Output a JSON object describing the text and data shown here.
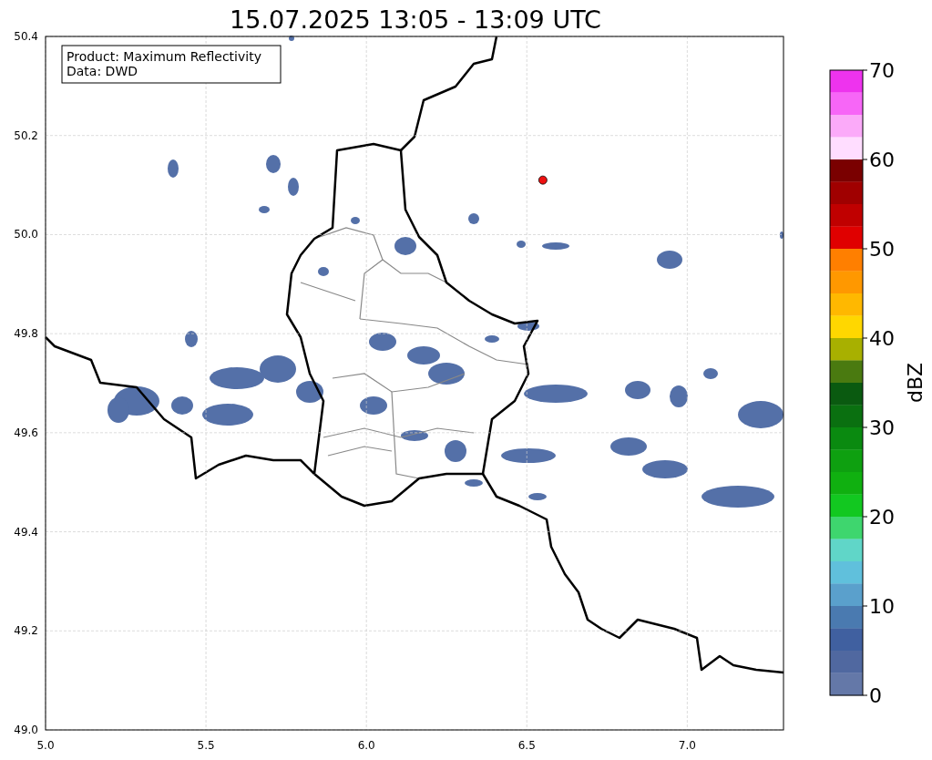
{
  "map": {
    "chart_data": {
      "type": "scatter",
      "title": "15.07.2025 13:05 - 13:09 UTC",
      "xlim": [
        5.0,
        7.3
      ],
      "ylim": [
        49.0,
        50.4
      ],
      "grid": true,
      "xticks": [
        {
          "value": 5.0,
          "label": "5.0"
        },
        {
          "value": 5.5,
          "label": "5.5"
        },
        {
          "value": 6.0,
          "label": "6.0"
        },
        {
          "value": 6.5,
          "label": "6.5"
        },
        {
          "value": 7.0,
          "label": "7.0"
        }
      ],
      "yticks": [
        {
          "value": 50.4,
          "label": "50.4"
        },
        {
          "value": 50.2,
          "label": "50.2"
        },
        {
          "value": 50.0,
          "label": "50.0"
        },
        {
          "value": 49.8,
          "label": "49.8"
        },
        {
          "value": 49.6,
          "label": "49.6"
        },
        {
          "value": 49.4,
          "label": "49.4"
        },
        {
          "value": 49.2,
          "label": "49.2"
        },
        {
          "value": 49.0,
          "label": "49.0"
        }
      ],
      "x": [
        6.55
      ],
      "series": [
        {
          "color": "#ee1111",
          "values": [
            50.11
          ]
        }
      ]
    },
    "info_box": {
      "lines": [
        "Product: Maximum Reflectivity",
        "Data: DWD"
      ]
    }
  },
  "colorbar": {
    "label": "dBZ",
    "ticks": [
      "70",
      "60",
      "50",
      "40",
      "30",
      "20",
      "10",
      "0"
    ],
    "bins": [
      {
        "color": "#ee33ee"
      },
      {
        "color": "#f766f7"
      },
      {
        "color": "#fbaaf9"
      },
      {
        "color": "#ffddff"
      },
      {
        "color": "#7a0000"
      },
      {
        "color": "#a00000"
      },
      {
        "color": "#c00000"
      },
      {
        "color": "#e00000"
      },
      {
        "color": "#ff7f00"
      },
      {
        "color": "#ff9800"
      },
      {
        "color": "#ffb800"
      },
      {
        "color": "#ffd700"
      },
      {
        "color": "#a8b000"
      },
      {
        "color": "#4a7a10"
      },
      {
        "color": "#0a5a10"
      },
      {
        "color": "#0a7010"
      },
      {
        "color": "#0a8a10"
      },
      {
        "color": "#0ea010"
      },
      {
        "color": "#10b010"
      },
      {
        "color": "#12c820"
      },
      {
        "color": "#3ed66e"
      },
      {
        "color": "#60d6c8"
      },
      {
        "color": "#60c0dc"
      },
      {
        "color": "#5aa0cc"
      },
      {
        "color": "#4a7ab0"
      },
      {
        "color": "#4060a0"
      },
      {
        "color": "#5068a0"
      },
      {
        "color": "#6478a8"
      }
    ]
  }
}
